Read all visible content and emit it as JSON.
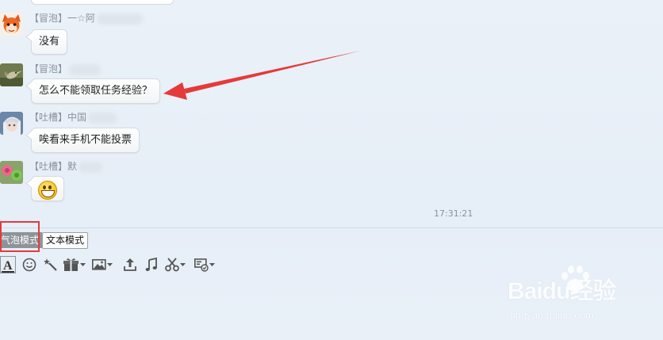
{
  "chat": {
    "messages": [
      {
        "tag": "【冒泡】",
        "name": "一☆阿",
        "text": "没有"
      },
      {
        "tag": "【冒泡】",
        "name": "",
        "text": "怎么不能领取任务经验？"
      },
      {
        "tag": "【吐槽】",
        "name": "中国",
        "text": "唉看来手机不能投票"
      },
      {
        "tag": "【吐槽】",
        "name": "默",
        "text": "",
        "emoji": "grin-emoji"
      }
    ],
    "timestamp": "17:31:21"
  },
  "mode_switch": {
    "bubble_mode": "气泡模式",
    "text_mode": "文本模式",
    "active": "bubble_mode"
  },
  "toolbar": {
    "icons": [
      "font-icon",
      "emoji-icon",
      "magic-wand-icon",
      "gift-box-icon",
      "image-icon",
      "upload-icon",
      "music-note-icon",
      "scissors-icon",
      "screenshot-icon"
    ]
  },
  "annotations": {
    "arrow_color": "#e53a3a",
    "highlight_color": "#e53a3a"
  },
  "watermark": {
    "logo": "Baidu经验",
    "url": "jingyan.baidu.com"
  },
  "colors": {
    "background": "#e8eff7",
    "bubble_border": "#d5d9de",
    "meta_text": "#8a929c",
    "active_mode_bg": "#8d9399"
  }
}
